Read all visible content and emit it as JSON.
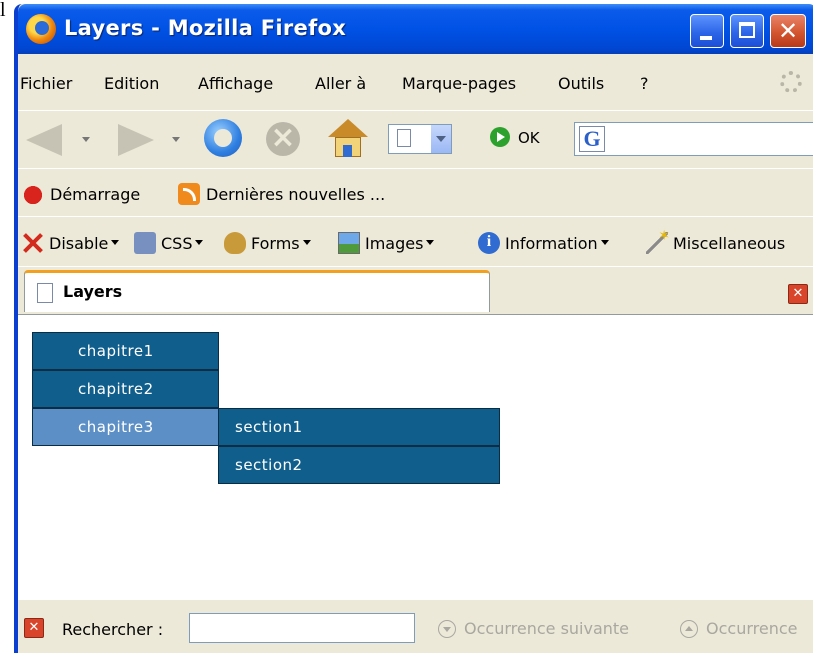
{
  "stray_glyph": "l",
  "window": {
    "title": "Layers - Mozilla Firefox"
  },
  "menubar": {
    "items": [
      "Fichier",
      "Edition",
      "Affichage",
      "Aller à",
      "Marque-pages",
      "Outils",
      "?"
    ]
  },
  "navbar": {
    "go_label": "OK",
    "search_engine_icon": "G"
  },
  "bookmarks": {
    "items": [
      {
        "label": "Démarrage",
        "icon": "redhat-icon"
      },
      {
        "label": "Dernières nouvelles ...",
        "icon": "rss-icon"
      }
    ]
  },
  "webdev_toolbar": {
    "items": [
      "Disable",
      "CSS",
      "Forms",
      "Images",
      "Information",
      "Miscellaneous"
    ]
  },
  "tab": {
    "label": "Layers"
  },
  "layers_menu": {
    "main_items": [
      {
        "label": "chapitre1",
        "state": "normal"
      },
      {
        "label": "chapitre2",
        "state": "normal"
      },
      {
        "label": "chapitre3",
        "state": "hover"
      }
    ],
    "submenu_items": [
      "section1",
      "section2"
    ],
    "colors": {
      "item_bg": "#105e8c",
      "hover_bg": "#5d8fc7",
      "border": "#0a2c44",
      "text": "#ffffff"
    }
  },
  "findbar": {
    "label": "Rechercher :",
    "value": "",
    "next_label": "Occurrence suivante",
    "prev_label": "Occurrence"
  },
  "theme": {
    "titlebar_blue": "#0052e6",
    "chrome_bg": "#ece9d8",
    "close_red": "#d4562f"
  }
}
